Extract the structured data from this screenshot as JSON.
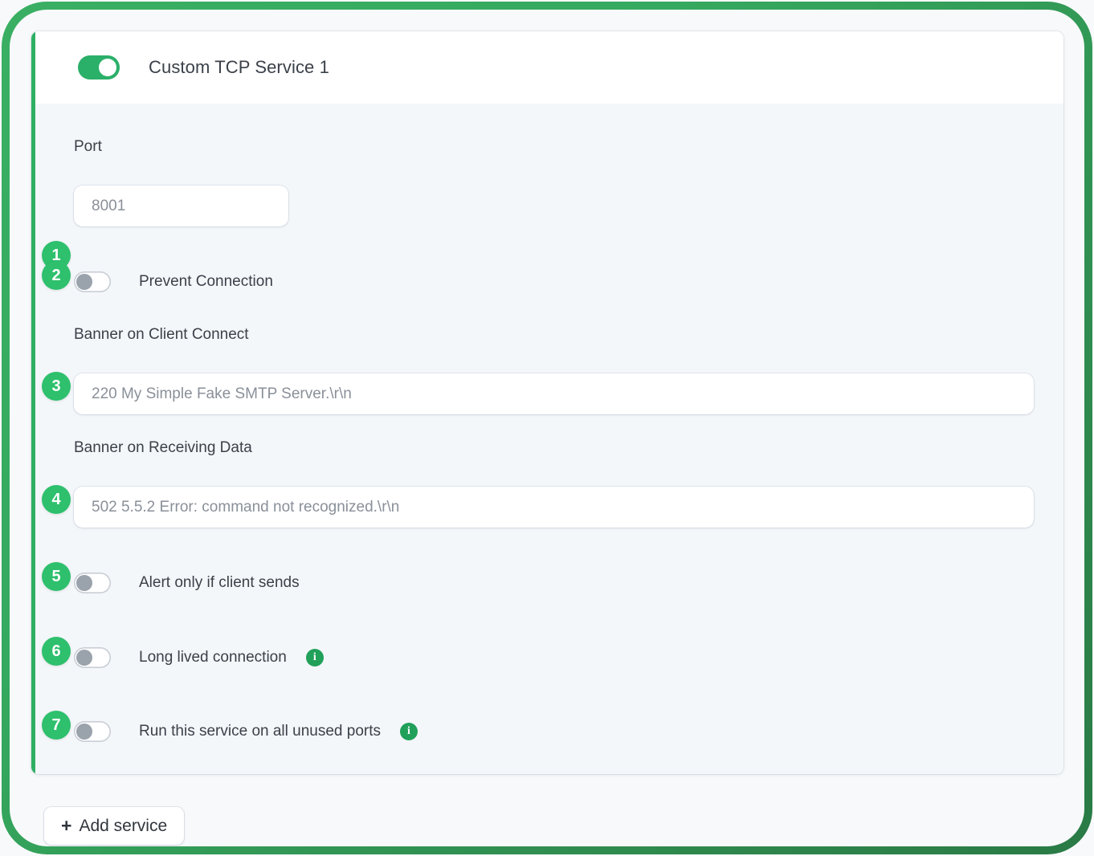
{
  "frame": {
    "accent_color": "#2eb062",
    "border_color": "#35a95f"
  },
  "card": {
    "header": {
      "toggle_state": "on",
      "title": "Custom TCP Service 1"
    },
    "fields": [
      {
        "badge": "1",
        "label": "Port",
        "placeholder": "8001",
        "value": ""
      },
      {
        "badge": "3",
        "label": "Banner on Client Connect",
        "placeholder": "220 My Simple Fake SMTP Server.\\r\\n",
        "value": ""
      },
      {
        "badge": "4",
        "label": "Banner on Receiving Data",
        "placeholder": "502 5.5.2 Error: command not recognized.\\r\\n",
        "value": ""
      }
    ],
    "toggles": [
      {
        "badge": "2",
        "label": "Prevent Connection",
        "state": "off",
        "info": false
      },
      {
        "badge": "5",
        "label": "Alert only if client sends",
        "state": "off",
        "info": false
      },
      {
        "badge": "6",
        "label": "Long lived connection",
        "state": "off",
        "info": true,
        "info_icon": "info-icon",
        "info_glyph": "i"
      },
      {
        "badge": "7",
        "label": "Run this service on all unused ports",
        "state": "off",
        "info": true,
        "info_icon": "info-icon",
        "info_glyph": "i"
      }
    ]
  },
  "footer": {
    "add_service_plus": "+",
    "add_service_label": "Add service"
  }
}
